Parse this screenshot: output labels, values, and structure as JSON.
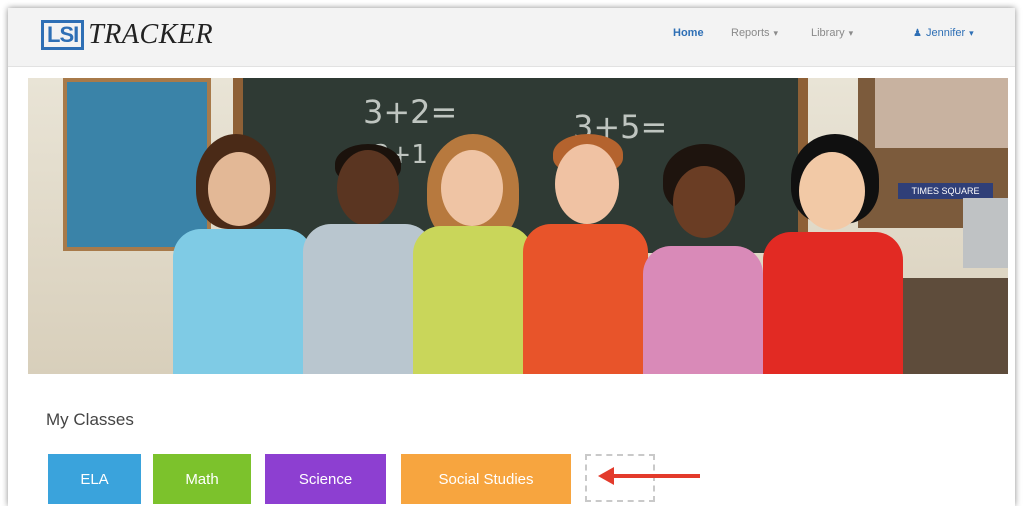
{
  "header": {
    "logo_box": "LSI",
    "logo_text": "TRACKER",
    "nav": {
      "home": "Home",
      "reports": "Reports",
      "library": "Library",
      "user": "Jennifer"
    },
    "icons": {
      "dropdown": "chevron-down-icon",
      "user": "user-icon"
    }
  },
  "hero": {
    "chalk_lines": [
      "3+2=",
      "3+5=",
      "3+1"
    ],
    "sign": "TIMES SQUARE"
  },
  "classes": {
    "title": "My Classes",
    "items": [
      {
        "label": "ELA",
        "color": "#3aa3dc"
      },
      {
        "label": "Math",
        "color": "#7cc22c"
      },
      {
        "label": "Science",
        "color": "#8d3fd1"
      },
      {
        "label": "Social Studies",
        "color": "#f7a53f"
      }
    ]
  },
  "colors": {
    "brand": "#2e6fb5",
    "arrow": "#e33a2b"
  }
}
